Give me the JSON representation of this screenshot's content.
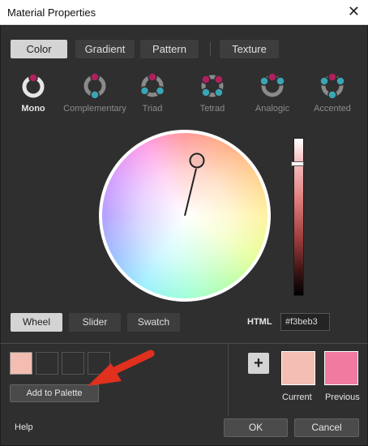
{
  "window": {
    "title": "Material Properties",
    "close_glyph": "✕"
  },
  "tabs": [
    {
      "label": "Color",
      "active": true
    },
    {
      "label": "Gradient"
    },
    {
      "label": "Pattern"
    },
    {
      "label": "Texture"
    }
  ],
  "harmonies": [
    {
      "label": "Mono",
      "icon": "mono-icon",
      "active": true
    },
    {
      "label": "Complementary",
      "icon": "complementary-icon"
    },
    {
      "label": "Triad",
      "icon": "triad-icon"
    },
    {
      "label": "Tetrad",
      "icon": "tetrad-icon"
    },
    {
      "label": "Analogic",
      "icon": "analogic-icon"
    },
    {
      "label": "Accented",
      "icon": "accented-icon"
    }
  ],
  "view_modes": [
    {
      "label": "Wheel",
      "active": true
    },
    {
      "label": "Slider"
    },
    {
      "label": "Swatch"
    }
  ],
  "html": {
    "label": "HTML",
    "value": "#f3beb3"
  },
  "palette": {
    "add_label": "Add to Palette"
  },
  "plus_glyph": "+",
  "preview": {
    "current_label": "Current",
    "current_color": "#f3beb3",
    "previous_label": "Previous",
    "previous_color": "#f07aa0"
  },
  "footer": {
    "help": "Help",
    "ok": "OK",
    "cancel": "Cancel"
  },
  "colors": {
    "accent_magenta": "#b0205e",
    "accent_teal": "#3aa5b5",
    "arrow_red": "#e0301e"
  }
}
